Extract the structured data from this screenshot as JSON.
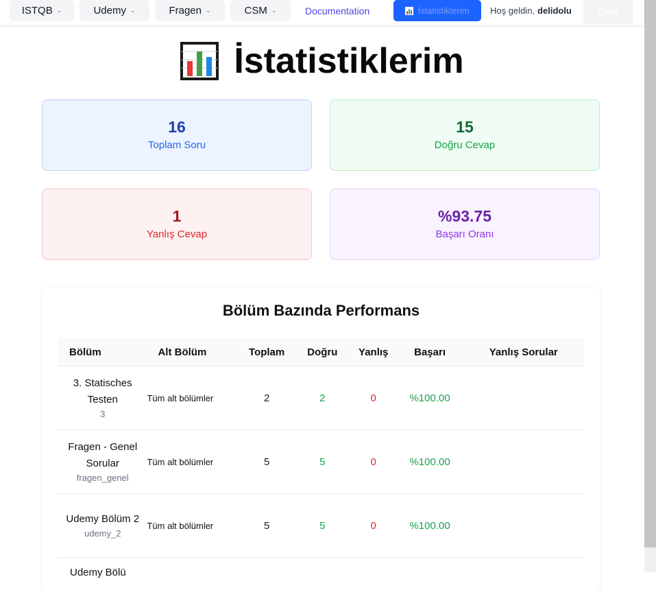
{
  "nav": {
    "menus": [
      {
        "label": "ISTQB",
        "name": "nav-istqb"
      },
      {
        "label": "Udemy",
        "name": "nav-udemy"
      },
      {
        "label": "Fragen",
        "name": "nav-fragen"
      },
      {
        "label": "CSM",
        "name": "nav-csm"
      }
    ],
    "documentation": "Documentation",
    "active": "İstatistiklerim",
    "welcome_prefix": "Hoş geldin,",
    "username": "delidolu",
    "logout": "Çıkış"
  },
  "page": {
    "title": "İstatistiklerim",
    "title_icon": "bar-chart-icon"
  },
  "stats": {
    "total": {
      "value": "16",
      "label": "Toplam Soru",
      "color": "#1e40af",
      "label_color": "#2563eb"
    },
    "correct": {
      "value": "15",
      "label": "Doğru Cevap",
      "color": "#166534",
      "label_color": "#16a34a"
    },
    "wrong": {
      "value": "1",
      "label": "Yanlış Cevap",
      "color": "#991b1b",
      "label_color": "#dc2626"
    },
    "rate": {
      "value": "%93.75",
      "label": "Başarı Oranı",
      "color": "#6b21a8",
      "label_color": "#9333ea"
    }
  },
  "performance": {
    "title": "Bölüm Bazında Performans",
    "headers": [
      "Bölüm",
      "Alt Bölüm",
      "Toplam",
      "Doğru",
      "Yanlış",
      "Başarı",
      "Yanlış Sorular"
    ],
    "rows": [
      {
        "section": "3. Statisches Testen",
        "code": "3",
        "sub": "Tüm alt bölümler",
        "total": "2",
        "correct": "2",
        "wrong": "0",
        "rate": "%100.00",
        "wrong_questions": ""
      },
      {
        "section": "Fragen - Genel Sorular",
        "code": "fragen_genel",
        "sub": "Tüm alt bölümler",
        "total": "5",
        "correct": "5",
        "wrong": "0",
        "rate": "%100.00",
        "wrong_questions": ""
      },
      {
        "section": "Udemy Bölüm 2",
        "code": "udemy_2",
        "sub": "Tüm alt bölümler",
        "total": "5",
        "correct": "5",
        "wrong": "0",
        "rate": "%100.00",
        "wrong_questions": ""
      }
    ],
    "partial_row": "Udemy Bölü"
  },
  "colors": {
    "accent": "#1d63ff",
    "success": "#16a34a",
    "danger": "#dc2626"
  }
}
